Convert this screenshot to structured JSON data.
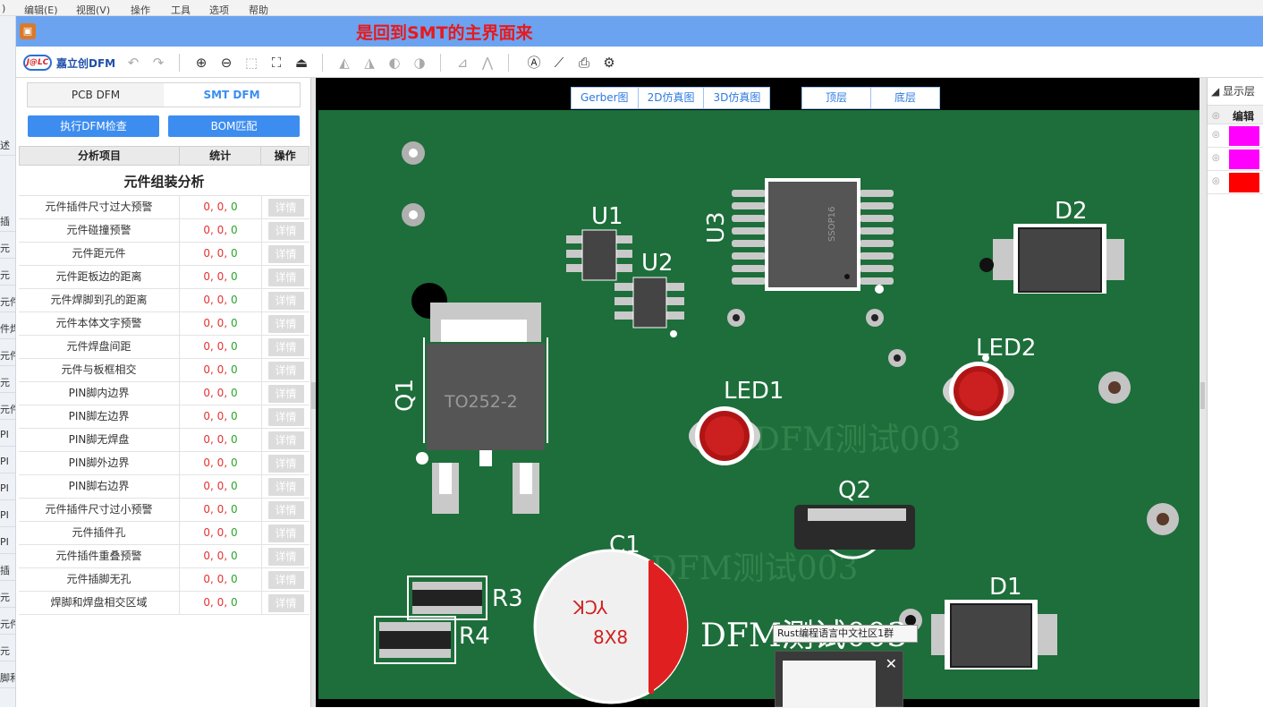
{
  "background_app": {
    "menu": [
      "编辑(E)",
      "视图(V)",
      "操作",
      "工具",
      "选项",
      "帮助"
    ],
    "left_fragments": [
      "述",
      "插",
      "元",
      "元",
      "元件",
      "件焊",
      "元件",
      "元",
      "元件",
      "PI",
      "PI",
      "PI",
      "PI",
      "PI",
      "插",
      "元",
      "元件",
      "元",
      "脚和"
    ]
  },
  "window": {
    "title": "是回到SMT的主界面来"
  },
  "toolbar": {
    "logo_badge": "J@LC",
    "logo_name": "嘉立创DFM",
    "icons": [
      "undo-icon",
      "redo-icon",
      "zoom-in-icon",
      "zoom-out-icon",
      "zoom-area-icon",
      "fit-view-icon",
      "flip-board-icon",
      "measure-1-icon",
      "measure-2-icon",
      "measure-3-icon",
      "measure-4-icon",
      "align-icon",
      "mirror-icon",
      "text-tool-icon",
      "ruler-icon",
      "export-pdf-icon",
      "settings-icon"
    ]
  },
  "left_panel": {
    "tabs": [
      "PCB DFM",
      "SMT DFM"
    ],
    "active_tab": "SMT DFM",
    "buttons": {
      "run_check": "执行DFM检查",
      "bom_match": "BOM匹配"
    },
    "table_headers": [
      "分析项目",
      "统计",
      "操作"
    ],
    "section_title": "元件组装分析",
    "detail_label": "详情",
    "rows": [
      {
        "name": "元件插件尺寸过大预警",
        "stats": [
          "0",
          "0",
          "0"
        ]
      },
      {
        "name": "元件碰撞预警",
        "stats": [
          "0",
          "0",
          "0"
        ]
      },
      {
        "name": "元件距元件",
        "stats": [
          "0",
          "0",
          "0"
        ]
      },
      {
        "name": "元件距板边的距离",
        "stats": [
          "0",
          "0",
          "0"
        ]
      },
      {
        "name": "元件焊脚到孔的距离",
        "stats": [
          "0",
          "0",
          "0"
        ]
      },
      {
        "name": "元件本体文字预警",
        "stats": [
          "0",
          "0",
          "0"
        ]
      },
      {
        "name": "元件焊盘间距",
        "stats": [
          "0",
          "0",
          "0"
        ]
      },
      {
        "name": "元件与板框相交",
        "stats": [
          "0",
          "0",
          "0"
        ]
      },
      {
        "name": "PIN脚内边界",
        "stats": [
          "0",
          "0",
          "0"
        ]
      },
      {
        "name": "PIN脚左边界",
        "stats": [
          "0",
          "0",
          "0"
        ]
      },
      {
        "name": "PIN脚无焊盘",
        "stats": [
          "0",
          "0",
          "0"
        ]
      },
      {
        "name": "PIN脚外边界",
        "stats": [
          "0",
          "0",
          "0"
        ]
      },
      {
        "name": "PIN脚右边界",
        "stats": [
          "0",
          "0",
          "0"
        ]
      },
      {
        "name": "元件插件尺寸过小预警",
        "stats": [
          "0",
          "0",
          "0"
        ]
      },
      {
        "name": "元件插件孔",
        "stats": [
          "0",
          "0",
          "0"
        ]
      },
      {
        "name": "元件插件重叠预警",
        "stats": [
          "0",
          "0",
          "0"
        ]
      },
      {
        "name": "元件插脚无孔",
        "stats": [
          "0",
          "0",
          "0"
        ]
      },
      {
        "name": "焊脚和焊盘相交区域",
        "stats": [
          "0",
          "0",
          "0"
        ]
      }
    ],
    "stat_colors": [
      "#e23333",
      "#e23333",
      "#2aa52a"
    ]
  },
  "view_modes": [
    "Gerber图",
    "2D仿真图",
    "3D仿真图"
  ],
  "layers": [
    "顶层",
    "底层"
  ],
  "pcb": {
    "board_color": "#1d6e3a",
    "watermarks": [
      "DFM测试003",
      "DFM测试003",
      "DFM测试003"
    ],
    "designators": [
      "U1",
      "U2",
      "U3",
      "D2",
      "Q1",
      "LED1",
      "LED2",
      "Q2",
      "C1",
      "D1",
      "R3",
      "R4"
    ],
    "body_texts": {
      "q1": "TO252-2",
      "u3": "SSOP16",
      "c1_top": "YCK",
      "c1_bottom": "8X8"
    }
  },
  "right_panel": {
    "title": "显示层",
    "header": "编辑",
    "swatches": [
      "#ff00ff",
      "#ff00ff",
      "#ff0000"
    ]
  },
  "popup": {
    "tooltip": "Rust编程语言中文社区1群",
    "close": "✕"
  }
}
